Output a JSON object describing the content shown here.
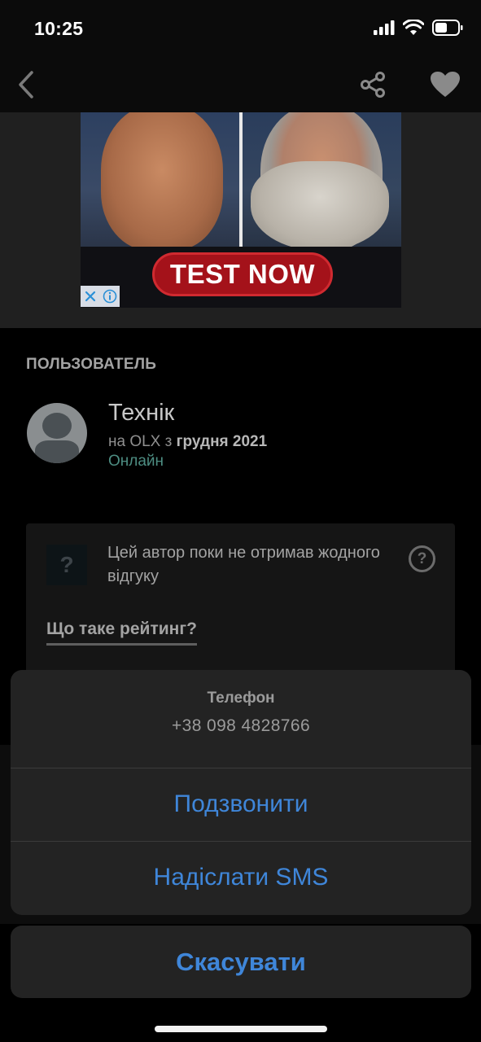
{
  "status_bar": {
    "time": "10:25",
    "icons": [
      "cellular-signal-icon",
      "wifi-icon",
      "battery-icon"
    ]
  },
  "nav": {
    "back_icon": "chevron-left-icon",
    "share_icon": "share-icon",
    "favorite_icon": "heart-icon"
  },
  "ad": {
    "cta": "TEST NOW",
    "choices_icons": [
      "close-icon",
      "info-icon"
    ]
  },
  "user": {
    "section_title": "ПОЛЬЗОВАТЕЛЬ",
    "name": "Технік",
    "since_prefix": "на OLX з",
    "since_date": "грудня 2021",
    "status": "Онлайн",
    "status_color": "#4d8d82"
  },
  "rating": {
    "icon_glyph": "?",
    "no_reviews_text": "Цей автор поки не отримав жодного відгуку",
    "help_glyph": "?",
    "link_label": "Що таке рейтинг?"
  },
  "action_sheet": {
    "title": "Телефон",
    "phone": "+38 098 4828766",
    "call_label": "Подзвонити",
    "sms_label": "Надіслати SMS",
    "cancel_label": "Скасувати",
    "accent_color": "#3f86d9"
  }
}
